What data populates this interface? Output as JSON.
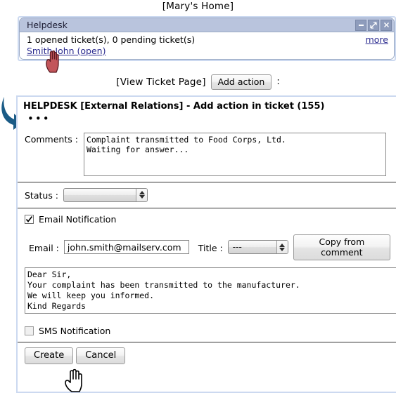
{
  "annotations": {
    "marys_home": "[Mary's Home]",
    "view_ticket_page": "[View Ticket Page]",
    "add_action_button": "Add action",
    "trailing_colon": ":"
  },
  "helpdesk_widget": {
    "title": "Helpdesk",
    "summary": "1 opened ticket(s), 0 pending ticket(s)",
    "more_link": "more",
    "ticket_link": "Smith John (open)",
    "window_buttons": [
      {
        "name": "minimize-button",
        "icon": "minimize-icon",
        "glyph": "–"
      },
      {
        "name": "maximize-button",
        "icon": "maximize-icon",
        "glyph": "⤡"
      },
      {
        "name": "close-button",
        "icon": "close-icon",
        "glyph": "✕"
      }
    ],
    "header_bg": "#b9c4dd",
    "border_color": "#ccd9f0"
  },
  "ticket_form": {
    "title": "HELPDESK [External Relations] - Add action in ticket (155)",
    "ellipsis": "•••",
    "comments": {
      "label": "Comments :",
      "value": "Complaint transmitted to Food Corps, Ltd.\nWaiting for answer..."
    },
    "status": {
      "label": "Status :",
      "value": "",
      "options": []
    },
    "email_notification": {
      "label": "Email Notification",
      "checked": true,
      "email_label": "Email :",
      "email_value": "john.smith@mailserv.com",
      "email_placeholder": "",
      "title_label": "Title :",
      "title_value": "---",
      "copy_button": "Copy from comment",
      "body_value": "Dear Sir,\nYour complaint has been transmitted to the manufacturer.\nWe will keep you informed.\nKind Regards"
    },
    "sms_notification": {
      "label": "SMS Notification",
      "checked": false
    },
    "buttons": {
      "create": "Create",
      "cancel": "Cancel"
    }
  },
  "cursors": {
    "link_hand": "pointing-hand-cursor",
    "create_hand": "pointing-hand-cursor"
  },
  "colors": {
    "link": "#2b2b8f",
    "panel_border": "#ccd9f0",
    "arrow": "#1a5b86"
  }
}
